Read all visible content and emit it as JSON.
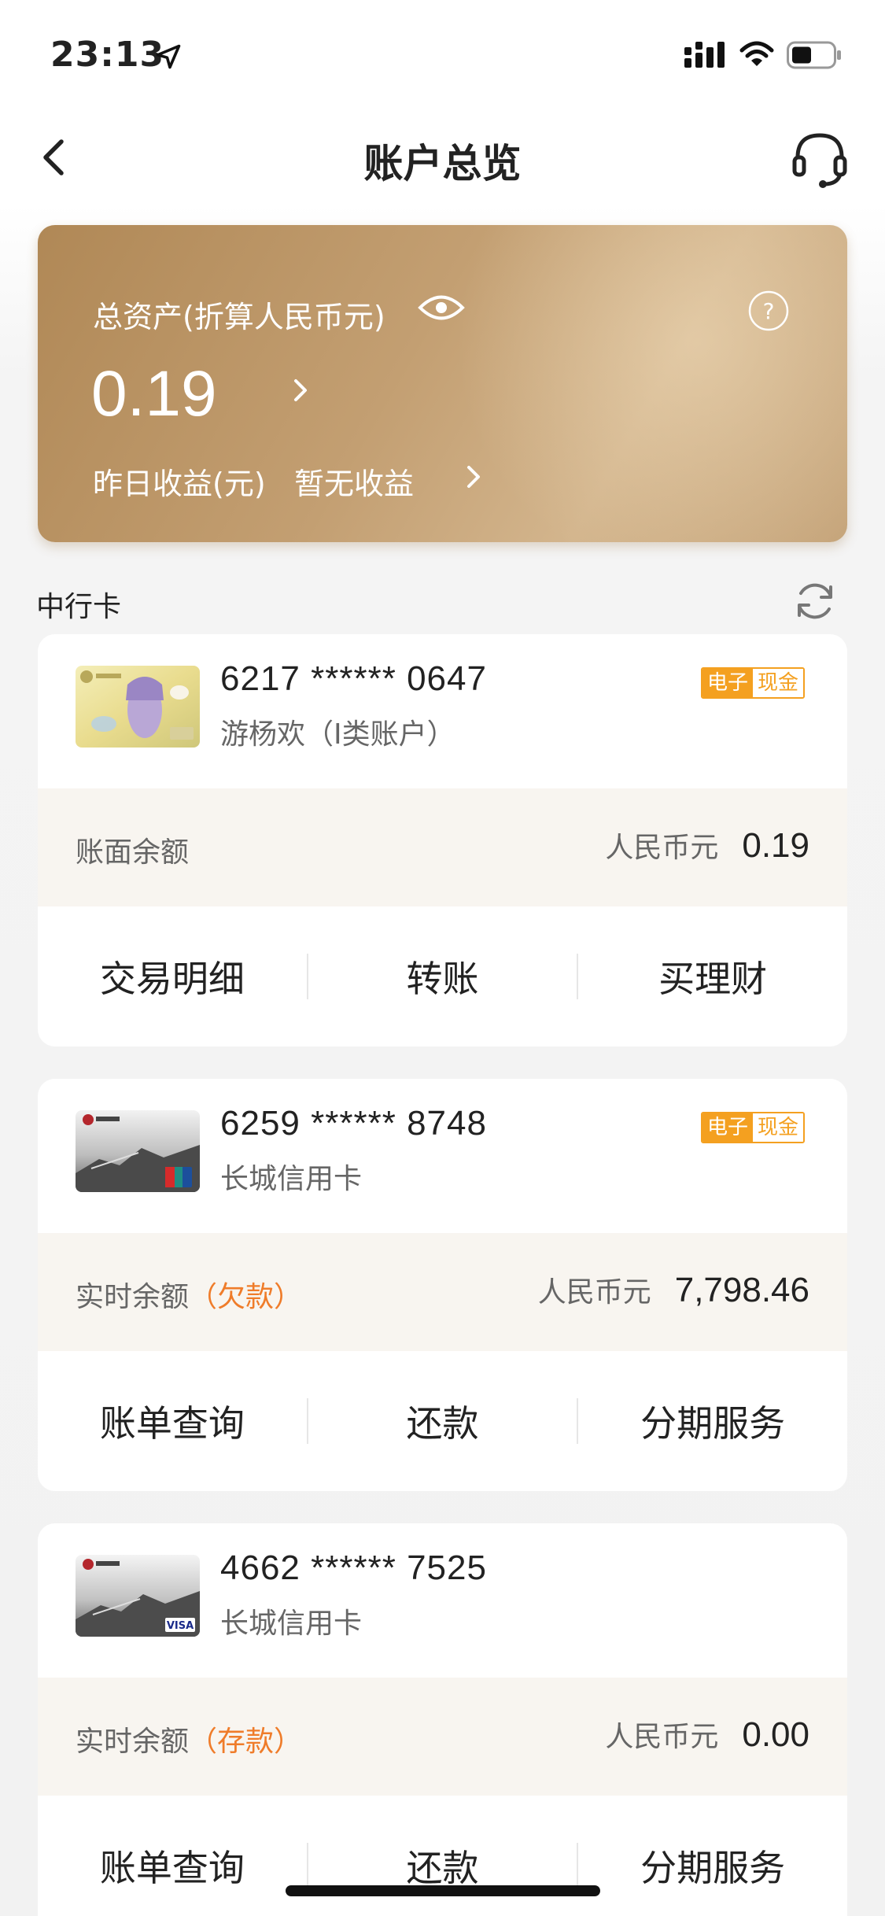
{
  "status_bar": {
    "time": "23:13",
    "icons": [
      "location-arrow-icon",
      "signal-icon",
      "wifi-icon",
      "battery-icon"
    ]
  },
  "nav": {
    "title": "账户总览",
    "back_icon": "chevron-left-icon",
    "service_icon": "headset-icon"
  },
  "asset_summary": {
    "label": "总资产(折算人民币元)",
    "value": "0.19",
    "yesterday_label": "昨日收益(元)",
    "yesterday_value": "暂无收益",
    "colors": {
      "card_gradient_start": "#b08856",
      "card_gradient_end": "#d3b58d"
    }
  },
  "section": {
    "title": "中行卡"
  },
  "accounts": [
    {
      "card_number": "6217 ****** 0647",
      "name": "游杨欢（I类账户）",
      "badge": [
        "电子",
        "现金"
      ],
      "balance_label": "账面余额",
      "balance_status": "",
      "currency": "人民币元",
      "amount": "0.19",
      "actions": [
        "交易明细",
        "转账",
        "买理财"
      ]
    },
    {
      "card_number": "6259 ****** 8748",
      "name": "长城信用卡",
      "badge": [
        "电子",
        "现金"
      ],
      "balance_label": "实时余额",
      "balance_status": "（欠款）",
      "currency": "人民币元",
      "amount": "7,798.46",
      "actions": [
        "账单查询",
        "还款",
        "分期服务"
      ]
    },
    {
      "card_number": "4662 ****** 7525",
      "name": "长城信用卡",
      "badge": [],
      "balance_label": "实时余额",
      "balance_status": "（存款）",
      "currency": "人民币元",
      "amount": "0.00",
      "actions": [
        "账单查询",
        "还款",
        "分期服务"
      ]
    }
  ],
  "theme": {
    "accent_orange": "#ef7c2a",
    "badge_orange": "#f4a020"
  }
}
